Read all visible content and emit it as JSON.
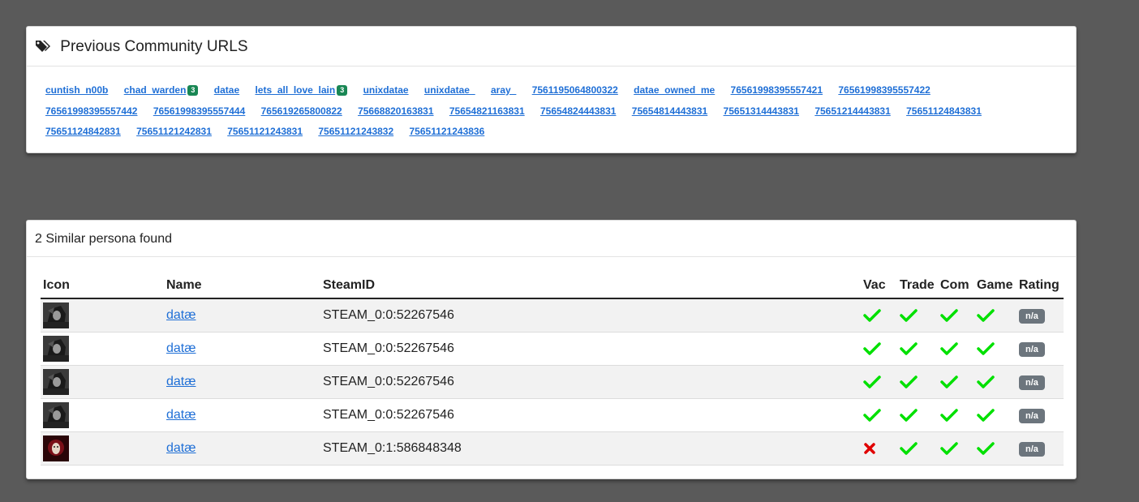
{
  "urls_card": {
    "title": "Previous Community URLS",
    "urls": [
      {
        "label": "cuntish_n00b"
      },
      {
        "label": "chad_warden",
        "badge": "3"
      },
      {
        "label": "datae"
      },
      {
        "label": "lets_all_love_lain",
        "badge": "3"
      },
      {
        "label": "unixdatae"
      },
      {
        "label": "unixdatae_"
      },
      {
        "label": "aray_"
      },
      {
        "label": "7561195064800322"
      },
      {
        "label": "datae_owned_me"
      },
      {
        "label": "76561998395557421"
      },
      {
        "label": "76561998395557422"
      },
      {
        "label": "76561998395557442"
      },
      {
        "label": "76561998395557444"
      },
      {
        "label": "765619265800822"
      },
      {
        "label": "75668820163831"
      },
      {
        "label": "75654821163831"
      },
      {
        "label": "75654824443831"
      },
      {
        "label": "75654814443831"
      },
      {
        "label": "75651314443831"
      },
      {
        "label": "75651214443831"
      },
      {
        "label": "75651124843831"
      },
      {
        "label": "75651124842831"
      },
      {
        "label": "75651121242831"
      },
      {
        "label": "75651121243831"
      },
      {
        "label": "75651121243832"
      },
      {
        "label": "75651121243836"
      }
    ]
  },
  "persona_card": {
    "title": "2 Similar persona found",
    "columns": [
      "Icon",
      "Name",
      "SteamID",
      "Vac",
      "Trade",
      "Com",
      "Game",
      "Rating"
    ],
    "rows": [
      {
        "avatar": "dark-avatar",
        "name": "datæ",
        "steamid": "STEAM_0:0:52267546",
        "vac": "ok",
        "trade": "ok",
        "com": "ok",
        "game": "ok",
        "rating": "n/a"
      },
      {
        "avatar": "dark-avatar",
        "name": "datæ",
        "steamid": "STEAM_0:0:52267546",
        "vac": "ok",
        "trade": "ok",
        "com": "ok",
        "game": "ok",
        "rating": "n/a"
      },
      {
        "avatar": "dark-avatar",
        "name": "datæ",
        "steamid": "STEAM_0:0:52267546",
        "vac": "ok",
        "trade": "ok",
        "com": "ok",
        "game": "ok",
        "rating": "n/a"
      },
      {
        "avatar": "dark-avatar",
        "name": "datæ",
        "steamid": "STEAM_0:0:52267546",
        "vac": "ok",
        "trade": "ok",
        "com": "ok",
        "game": "ok",
        "rating": "n/a"
      },
      {
        "avatar": "red-avatar",
        "name": "datæ",
        "steamid": "STEAM_0:1:586848348",
        "vac": "banned",
        "trade": "ok",
        "com": "ok",
        "game": "ok",
        "rating": "n/a"
      }
    ]
  },
  "colors": {
    "background": "#5a5a5a",
    "link": "#1f6fd6",
    "badge": "#198754",
    "check": "#00e000",
    "cross": "#e00000",
    "rating_badge": "#6c757d"
  }
}
